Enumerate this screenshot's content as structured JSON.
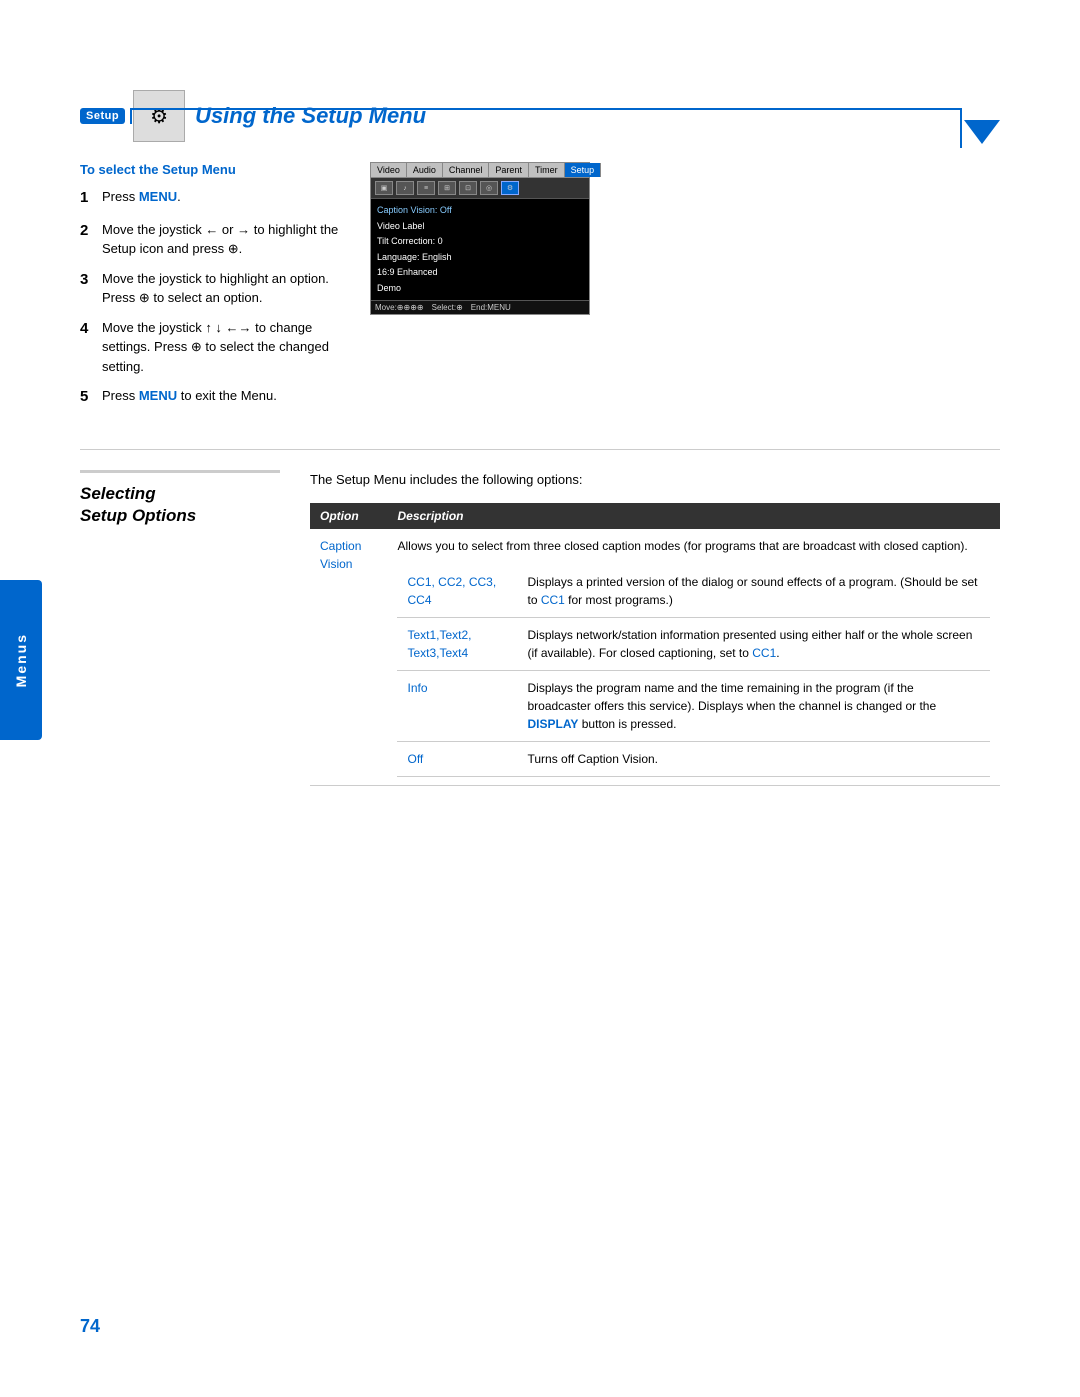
{
  "page": {
    "number": "74",
    "side_tab": "Menus"
  },
  "section1": {
    "badge": "Setup",
    "title": "Using the Setup Menu",
    "to_select_heading": "To select the Setup Menu",
    "steps": [
      {
        "number": "1",
        "text": "Press ",
        "highlight": "MENU",
        "rest": "."
      },
      {
        "number": "2",
        "text": "Move the joystick ← or → to highlight the Setup icon and press ⊕."
      },
      {
        "number": "3",
        "text": "Move the joystick to highlight an option. Press ⊕ to select an option."
      },
      {
        "number": "4",
        "text": "Move the joystick ↑ ↓ ←→ to change settings. Press ⊕ to select the changed setting."
      },
      {
        "number": "5",
        "text": "Press ",
        "highlight": "MENU",
        "rest": " to exit the Menu."
      }
    ],
    "tv_menu": {
      "tabs": [
        "Video",
        "Audio",
        "Channel",
        "Parent",
        "Timer",
        "Setup"
      ],
      "items": [
        "Caption Vision: Off",
        "Video Label",
        "Tilt Correction: 0",
        "Language: English",
        "16:9 Enhanced",
        "Demo"
      ],
      "footer": "Move:⊕⊕⊕⊕  Select:⊕  End:MENU"
    }
  },
  "section2": {
    "title_line1": "Selecting",
    "title_line2": "Setup Options",
    "intro": "The Setup Menu includes the following options:",
    "table": {
      "headers": [
        "Option",
        "Description"
      ],
      "rows": [
        {
          "option": "Caption Vision",
          "description": "Allows you to select from three closed caption modes (for programs that are broadcast with closed caption).",
          "sub_rows": [
            {
              "sub_option": "CC1, CC2, CC3, CC4",
              "sub_description": "Displays a printed version of the dialog or sound effects of a program. (Should be set to CC1 for most programs.)"
            },
            {
              "sub_option": "Text1,Text2, Text3,Text4",
              "sub_description": "Displays network/station information presented using either half or the whole screen (if available). For closed captioning, set to CC1."
            },
            {
              "sub_option": "Info",
              "sub_description": "Displays the program name and the time remaining in the program (if the broadcaster offers this service). Displays when the channel is changed or the DISPLAY button is pressed."
            },
            {
              "sub_option": "Off",
              "sub_description": "Turns off Caption Vision."
            }
          ]
        }
      ]
    }
  }
}
